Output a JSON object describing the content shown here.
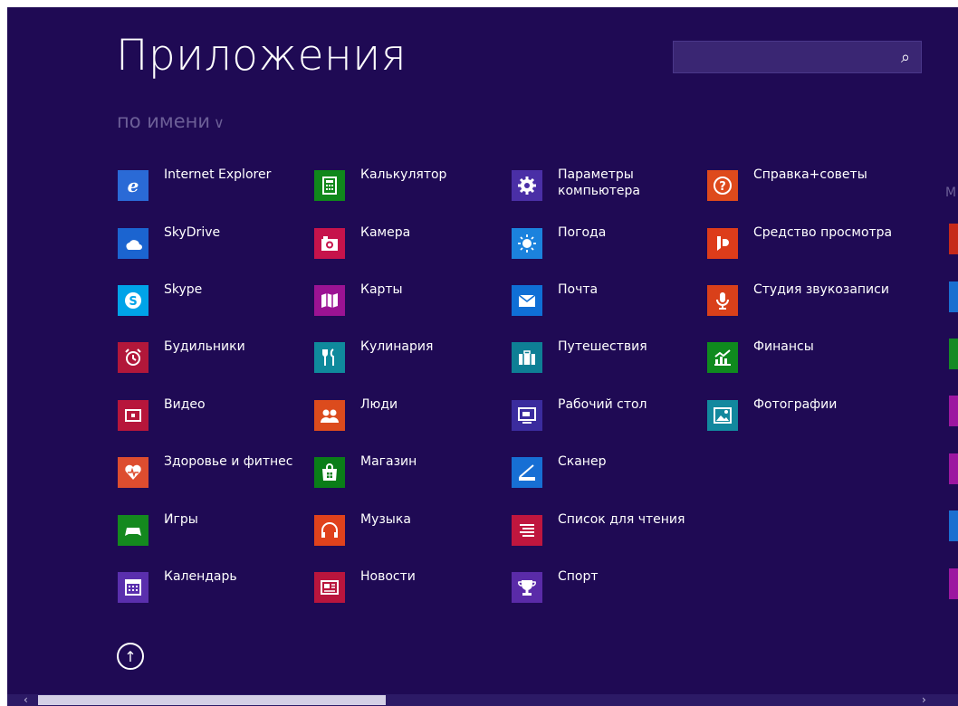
{
  "header": {
    "title": "Приложения",
    "sort_label": "по имени",
    "search_placeholder": ""
  },
  "columns": [
    [
      {
        "label": "Internet Explorer",
        "icon": "internet-explorer-icon",
        "color": "#2a6ad6"
      },
      {
        "label": "SkyDrive",
        "icon": "cloud-icon",
        "color": "#1b64d0"
      },
      {
        "label": "Skype",
        "icon": "skype-icon",
        "color": "#00a3e8"
      },
      {
        "label": "Будильники",
        "icon": "alarm-clock-icon",
        "color": "#b2173a"
      },
      {
        "label": "Видео",
        "icon": "video-icon",
        "color": "#b7163b"
      },
      {
        "label": "Здоровье и фитнес",
        "icon": "heart-pulse-icon",
        "color": "#dd4d2f"
      },
      {
        "label": "Игры",
        "icon": "game-controller-icon",
        "color": "#14891e"
      },
      {
        "label": "Календарь",
        "icon": "calendar-icon",
        "color": "#5a2fad"
      }
    ],
    [
      {
        "label": "Калькулятор",
        "icon": "calculator-icon",
        "color": "#10871b"
      },
      {
        "label": "Камера",
        "icon": "camera-icon",
        "color": "#c6134b"
      },
      {
        "label": "Карты",
        "icon": "map-icon",
        "color": "#9b1393"
      },
      {
        "label": "Кулинария",
        "icon": "fork-knife-icon",
        "color": "#0f8a9c"
      },
      {
        "label": "Люди",
        "icon": "people-icon",
        "color": "#dc4b1d"
      },
      {
        "label": "Магазин",
        "icon": "store-icon",
        "color": "#0a7d18"
      },
      {
        "label": "Музыка",
        "icon": "headphones-icon",
        "color": "#e0421c"
      },
      {
        "label": "Новости",
        "icon": "news-icon",
        "color": "#b9153d"
      }
    ],
    [
      {
        "label": "Параметры компьютера",
        "icon": "gear-icon",
        "color": "#4a2fa6"
      },
      {
        "label": "Погода",
        "icon": "sun-icon",
        "color": "#1b82dd"
      },
      {
        "label": "Почта",
        "icon": "mail-icon",
        "color": "#0f6fd6"
      },
      {
        "label": "Путешествия",
        "icon": "suitcase-icon",
        "color": "#0e7f95"
      },
      {
        "label": "Рабочий стол",
        "icon": "desktop-icon",
        "color": "#3b2c9e"
      },
      {
        "label": "Сканер",
        "icon": "scanner-icon",
        "color": "#176fd4"
      },
      {
        "label": "Список для чтения",
        "icon": "reading-list-icon",
        "color": "#bf163e"
      },
      {
        "label": "Спорт",
        "icon": "trophy-icon",
        "color": "#5a2ba8"
      }
    ],
    [
      {
        "label": "Справка+советы",
        "icon": "help-icon",
        "color": "#de4a1c"
      },
      {
        "label": "Средство просмотра",
        "icon": "reader-icon",
        "color": "#dd3c1a"
      },
      {
        "label": "Студия звукозаписи",
        "icon": "microphone-icon",
        "color": "#d9401a"
      },
      {
        "label": "Финансы",
        "icon": "finance-chart-icon",
        "color": "#0f8a1e"
      },
      {
        "label": "Фотографии",
        "icon": "photo-icon",
        "color": "#12889e"
      }
    ]
  ],
  "edge_letter": "М",
  "edge_tiles": [
    "#c62a1a",
    "#1a6fd0",
    "#168a25",
    "#9c17a0",
    "#9c17a0",
    "#1a6fd0",
    "#9c17a0"
  ]
}
